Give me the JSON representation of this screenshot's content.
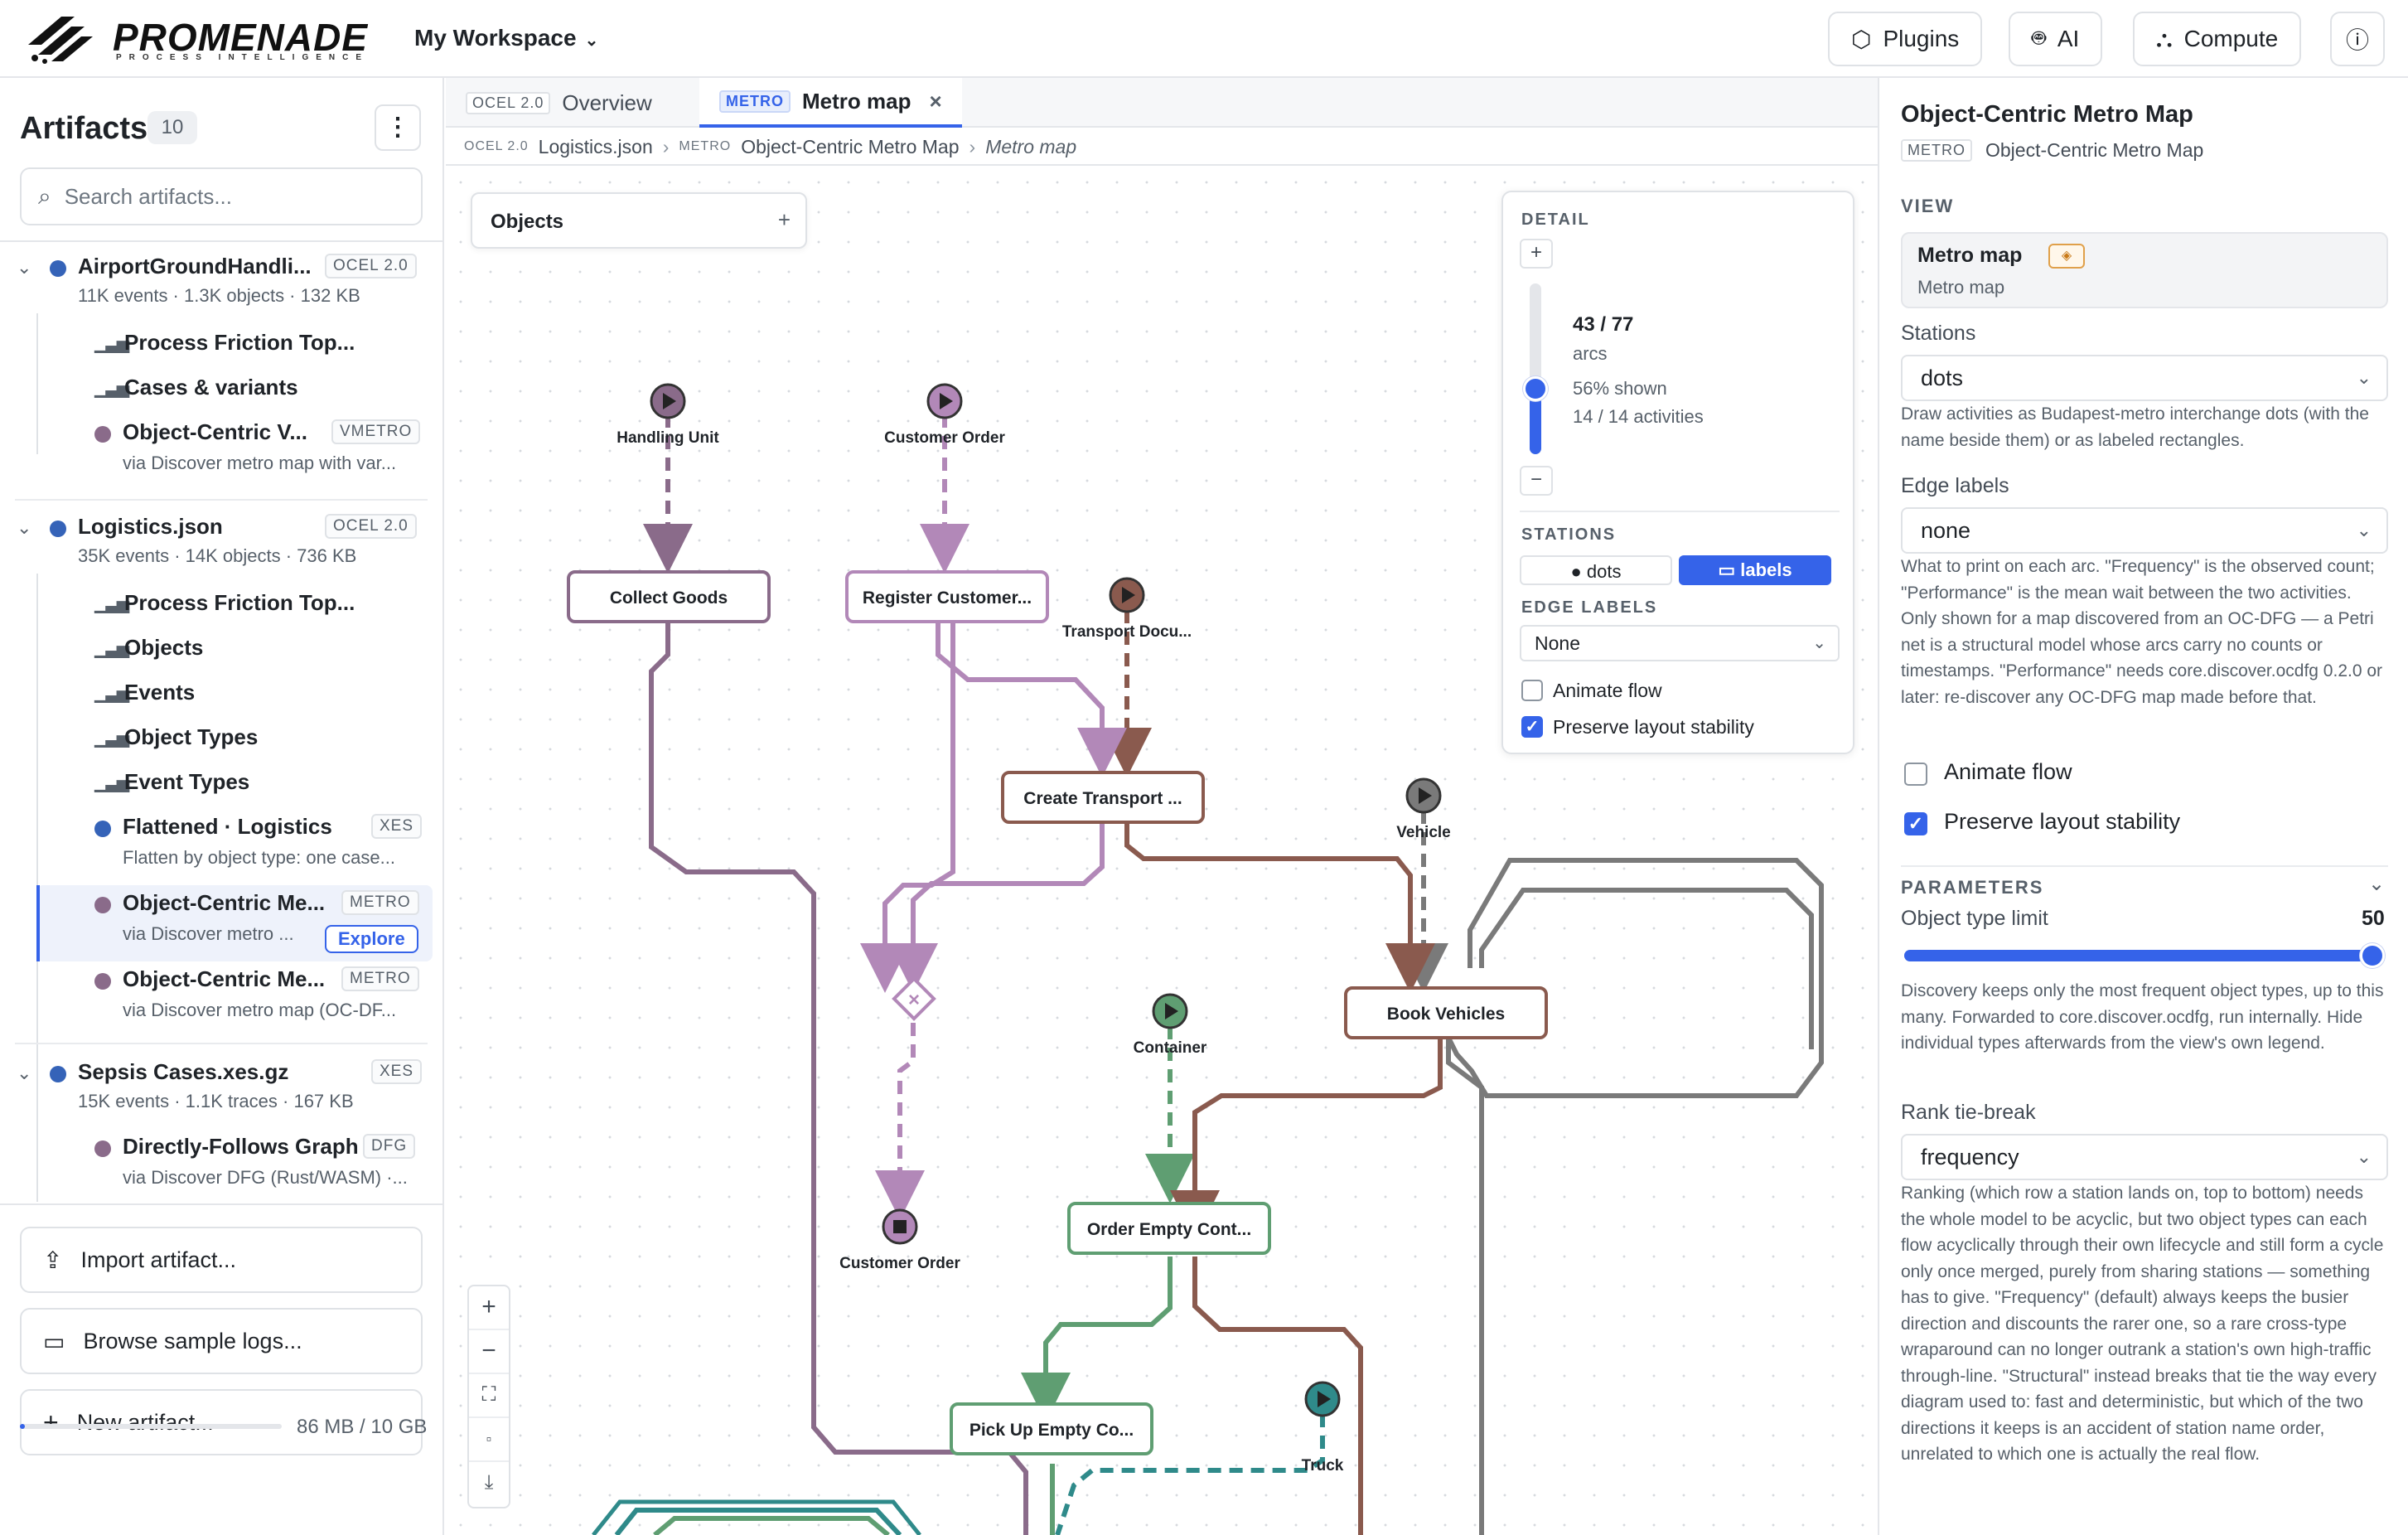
{
  "app": {
    "brand": "PROMENADE",
    "brand_sub": "PROCESS INTELLIGENCE",
    "workspace": "My Workspace",
    "buttons": {
      "plugins": "Plugins",
      "ai": "AI",
      "compute": "Compute"
    }
  },
  "sidebar": {
    "title": "Artifacts",
    "count": "10",
    "search_placeholder": "Search artifacts...",
    "groups": [
      {
        "name": "AirportGroundHandli...",
        "badge": "OCEL 2.0",
        "meta": "11K events · 1.3K objects · 132 KB",
        "color": "#3563b8",
        "children": [
          {
            "name": "Process Friction Top...",
            "type": "report"
          },
          {
            "name": "Cases & variants",
            "type": "report"
          },
          {
            "name": "Object-Centric V...",
            "badge": "VMETRO",
            "meta": "via Discover metro map with var...",
            "color": "#8a6b8a"
          }
        ]
      },
      {
        "name": "Logistics.json",
        "badge": "OCEL 2.0",
        "meta": "35K events · 14K objects · 736 KB",
        "color": "#3563b8",
        "children": [
          {
            "name": "Process Friction Top...",
            "type": "report"
          },
          {
            "name": "Objects",
            "type": "report"
          },
          {
            "name": "Events",
            "type": "report"
          },
          {
            "name": "Object Types",
            "type": "report"
          },
          {
            "name": "Event Types",
            "type": "report"
          },
          {
            "name": "Flattened · Logistics",
            "badge": "XES",
            "meta": "Flatten by object type: one case...",
            "color": "#3563b8"
          },
          {
            "name": "Object-Centric Me...",
            "badge": "METRO",
            "meta": "via Discover metro ...",
            "action": "Explore",
            "color": "#8a6b8a"
          },
          {
            "name": "Object-Centric Me...",
            "badge": "METRO",
            "meta": "via Discover metro map (OC-DF...",
            "color": "#8a6b8a"
          }
        ]
      },
      {
        "name": "Sepsis Cases.xes.gz",
        "badge": "XES",
        "meta": "15K events · 1.1K traces · 167 KB",
        "color": "#3563b8",
        "children": [
          {
            "name": "Directly-Follows Graph",
            "badge": "DFG",
            "meta": "via Discover DFG (Rust/WASM) ·...",
            "color": "#8a6b8a"
          }
        ]
      }
    ],
    "actions": {
      "import": "Import artifact...",
      "browse": "Browse sample logs...",
      "new": "New artifact..."
    },
    "memory": {
      "text": "86 MB / 10 GB",
      "fraction": 0.0086
    }
  },
  "tabs": [
    {
      "tag": "OCEL 2.0",
      "label": "Overview",
      "active": false
    },
    {
      "tag": "METRO",
      "label": "Metro map",
      "active": true
    }
  ],
  "breadcrumb": {
    "tag1": "OCEL 2.0",
    "file": "Logistics.json",
    "tag2": "METRO",
    "map": "Object-Centric Metro Map",
    "view": "Metro map"
  },
  "canvas": {
    "objects_label": "Objects",
    "objects_add": "+",
    "detail": {
      "label": "DETAIL",
      "arcs": "43 / 77",
      "arcs_unit": "arcs",
      "shown": "56% shown",
      "activities": "14 / 14 activities",
      "level": 0.56,
      "stations_label": "STATIONS",
      "stations_options": [
        "● dots",
        "▭ labels"
      ],
      "stations_selected": "labels",
      "edge_labels_label": "EDGE LABELS",
      "edge_labels_value": "None",
      "animate_flow": "Animate flow",
      "animate_flow_checked": false,
      "preserve_layout": "Preserve layout stability",
      "preserve_layout_checked": true
    },
    "metro": {
      "object_types": [
        {
          "name": "Handling Unit",
          "color": "#8a6b8a"
        },
        {
          "name": "Customer Order",
          "color": "#b288b8"
        },
        {
          "name": "Transport Document",
          "color": "#8a5a4e"
        },
        {
          "name": "Vehicle",
          "color": "#7a7a7a"
        },
        {
          "name": "Container",
          "color": "#5f9e72"
        },
        {
          "name": "Truck",
          "color": "#2f8a8a"
        }
      ],
      "start_labels": {
        "handling_unit": "Handling Unit",
        "customer_order": "Customer Order",
        "transport_doc": "Transport Docu...",
        "vehicle": "Vehicle",
        "container": "Container",
        "truck": "Truck"
      },
      "end_labels": {
        "customer_order": "Customer Order"
      },
      "activities": {
        "collect_goods": "Collect Goods",
        "register_customer": "Register Customer...",
        "create_transport": "Create Transport ...",
        "book_vehicles": "Book Vehicles",
        "order_empty": "Order Empty Cont...",
        "pick_up_empty": "Pick Up Empty Co..."
      }
    }
  },
  "right_panel": {
    "title": "Object-Centric Metro Map",
    "tag": "METRO",
    "subtitle": "Object-Centric Metro Map",
    "view_label": "VIEW",
    "view_title": "Metro map",
    "view_sub": "Metro map",
    "stations_label": "Stations",
    "stations_value": "dots",
    "stations_help": "Draw activities as Budapest-metro interchange dots (with the name beside them) or as labeled rectangles.",
    "edge_labels_label": "Edge labels",
    "edge_labels_value": "none",
    "edge_labels_help": "What to print on each arc. \"Frequency\" is the observed count; \"Performance\" is the mean wait between the two activities. Only shown for a map discovered from an OC-DFG — a Petri net is a structural model whose arcs carry no counts or timestamps. \"Performance\" needs core.discover.ocdfg 0.2.0 or later: re-discover any OC-DFG map made before that.",
    "animate_flow": "Animate flow",
    "animate_flow_checked": false,
    "preserve_layout": "Preserve layout stability",
    "preserve_layout_checked": true,
    "parameters_label": "PARAMETERS",
    "otl_label": "Object type limit",
    "otl_value": "50",
    "otl_help": "Discovery keeps only the most frequent object types, up to this many. Forwarded to core.discover.ocdfg, run internally. Hide individual types afterwards from the view's own legend.",
    "rank_label": "Rank tie-break",
    "rank_value": "frequency",
    "rank_help": "Ranking (which row a station lands on, top to bottom) needs the whole model to be acyclic, but two object types can each flow acyclically through their own lifecycle and still form a cycle only once merged, purely from sharing stations — something has to give. \"Frequency\" (default) always keeps the busier direction and discounts the rarer one, so a rare cross-type wraparound can no longer outrank a station's own high-traffic through-line. \"Structural\" instead breaks that tie the way every diagram used to: fast and deterministic, but which of the two directions it keeps is an accident of station name order, unrelated to which one is actually the real flow."
  }
}
